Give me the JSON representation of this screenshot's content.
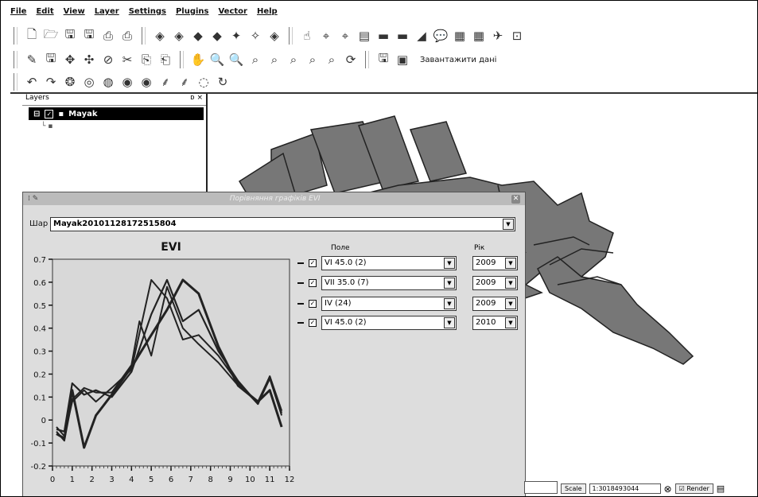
{
  "menu": [
    "File",
    "Edit",
    "View",
    "Layer",
    "Settings",
    "Plugins",
    "Vector",
    "Help"
  ],
  "toolbar": {
    "load_label": "Завантажити дані"
  },
  "layers_panel": {
    "title": "Layers",
    "controls": "ᴅ ×",
    "layer_name": "Mayak"
  },
  "dialog": {
    "title": "Порівняння графіків EVI",
    "layer_label": "Шар",
    "layer_value": "Mayak20101128172515804",
    "field_header": "Поле",
    "year_header": "Рік",
    "rows": [
      {
        "field": "VI 45.0 (2)",
        "year": "2009"
      },
      {
        "field": "VII 35.0 (7)",
        "year": "2009"
      },
      {
        "field": "IV  (24)",
        "year": "2009"
      },
      {
        "field": "VI 45.0 (2)",
        "year": "2010"
      }
    ]
  },
  "chart_data": {
    "type": "line",
    "title": "EVI",
    "xlabel": "",
    "ylabel": "",
    "xlim": [
      0,
      12
    ],
    "ylim": [
      -0.2,
      0.7
    ],
    "x_ticks": [
      0,
      1,
      2,
      3,
      4,
      5,
      6,
      7,
      8,
      9,
      10,
      11,
      12
    ],
    "y_ticks": [
      -0.2,
      -0.1,
      0,
      0.1,
      0.2,
      0.3,
      0.4,
      0.5,
      0.6,
      0.7
    ],
    "series": [
      {
        "x": [
          0.2,
          0.6,
          1.0,
          1.6,
          2.2,
          3.0,
          4.0,
          5.0,
          5.8,
          6.6,
          7.4,
          8.4,
          9.4,
          10.4,
          11.0,
          11.6
        ],
        "y": [
          -0.06,
          -0.08,
          0.13,
          -0.12,
          0.02,
          0.11,
          0.23,
          0.37,
          0.48,
          0.61,
          0.55,
          0.32,
          0.15,
          0.08,
          0.13,
          -0.03
        ]
      },
      {
        "x": [
          0.2,
          0.6,
          1.0,
          1.6,
          2.2,
          3.0,
          4.0,
          5.0,
          5.8,
          6.6,
          7.4,
          8.4,
          9.4,
          10.4,
          11.0,
          11.6
        ],
        "y": [
          -0.04,
          -0.05,
          0.16,
          0.11,
          0.13,
          0.1,
          0.21,
          0.46,
          0.61,
          0.43,
          0.48,
          0.3,
          0.17,
          0.07,
          0.19,
          0.04
        ]
      },
      {
        "x": [
          0.2,
          0.6,
          1.0,
          1.6,
          2.2,
          3.0,
          4.0,
          5.0,
          5.8,
          6.6,
          7.4,
          8.4,
          9.4,
          10.4,
          11.0,
          11.6
        ],
        "y": [
          -0.03,
          -0.07,
          0.08,
          0.13,
          0.08,
          0.14,
          0.22,
          0.61,
          0.53,
          0.35,
          0.37,
          0.28,
          0.16,
          0.07,
          0.18,
          0.02
        ]
      },
      {
        "x": [
          0.2,
          0.6,
          1.0,
          1.6,
          2.2,
          3.0,
          4.0,
          4.4,
          5.0,
          5.8,
          6.6,
          7.4,
          8.4,
          9.4,
          10.4,
          11.0,
          11.6
        ],
        "y": [
          -0.05,
          -0.09,
          0.09,
          0.14,
          0.12,
          0.12,
          0.24,
          0.43,
          0.28,
          0.58,
          0.4,
          0.33,
          0.25,
          0.15,
          0.08,
          0.19,
          0.03
        ]
      }
    ]
  },
  "statusbar": {
    "scale_label": "Scale",
    "scale_value": "1:3018493044",
    "render_label": "Render"
  }
}
